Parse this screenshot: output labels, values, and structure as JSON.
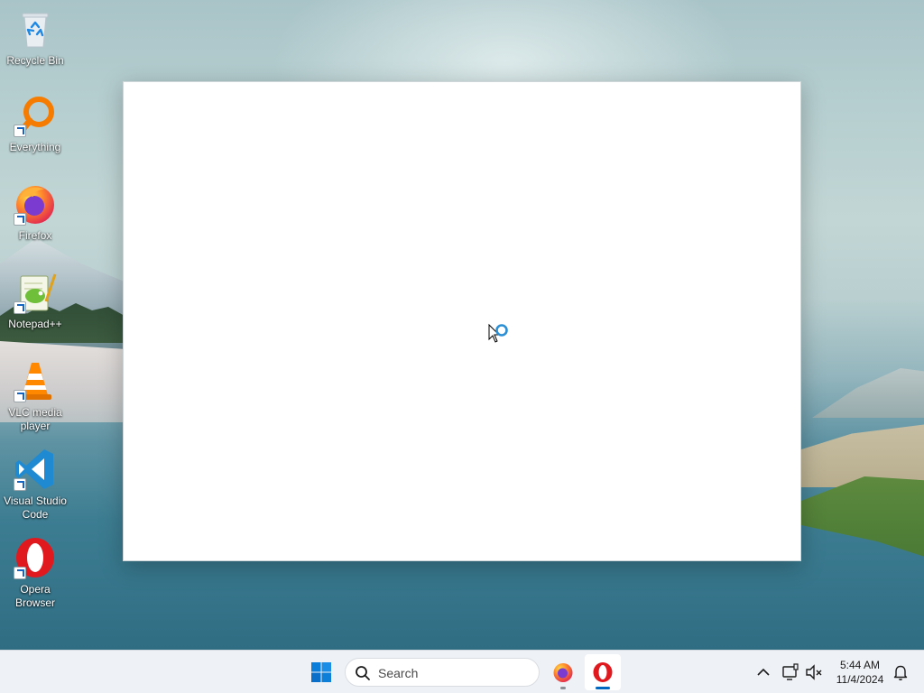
{
  "desktop": {
    "icons": [
      {
        "label": "Recycle Bin",
        "icon": "recycle-bin-icon"
      },
      {
        "label": "Everything",
        "icon": "everything-search-icon"
      },
      {
        "label": "Firefox",
        "icon": "firefox-icon"
      },
      {
        "label": "Notepad++",
        "icon": "notepad-plus-plus-icon"
      },
      {
        "label": "VLC media player",
        "icon": "vlc-cone-icon"
      },
      {
        "label": "Visual Studio Code",
        "icon": "vscode-icon"
      },
      {
        "label": "Opera Browser",
        "icon": "opera-icon"
      }
    ]
  },
  "taskbar": {
    "search_placeholder": "Search",
    "pinned_apps": [
      {
        "name": "Firefox",
        "icon": "firefox-icon",
        "running": true
      },
      {
        "name": "Opera",
        "icon": "opera-icon",
        "running": true,
        "active": true
      }
    ],
    "clock": {
      "time": "5:44 AM",
      "date": "11/4/2024"
    }
  },
  "colors": {
    "taskbar_bg": "#eef1f5",
    "accent": "#0067c0",
    "opera_red": "#e0191f",
    "firefox_orange": "#ff7139"
  }
}
